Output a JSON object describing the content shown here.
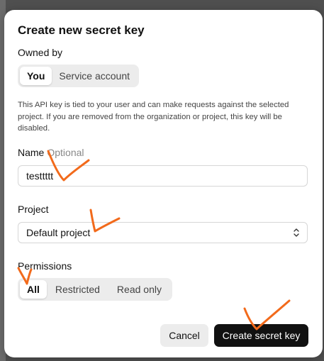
{
  "modal": {
    "title": "Create new secret key",
    "owned_by": {
      "label": "Owned by",
      "options": [
        "You",
        "Service account"
      ],
      "selected": "You"
    },
    "help_text": "This API key is tied to your user and can make requests against the selected project. If you are removed from the organization or project, this key will be disabled.",
    "name": {
      "label": "Name",
      "optional_label": "Optional",
      "value": "testtttt"
    },
    "project": {
      "label": "Project",
      "value": "Default project"
    },
    "permissions": {
      "label": "Permissions",
      "options": [
        "All",
        "Restricted",
        "Read only"
      ],
      "selected": "All"
    },
    "buttons": {
      "cancel": "Cancel",
      "create": "Create secret key"
    }
  },
  "annotation_color": "#f26a1b"
}
